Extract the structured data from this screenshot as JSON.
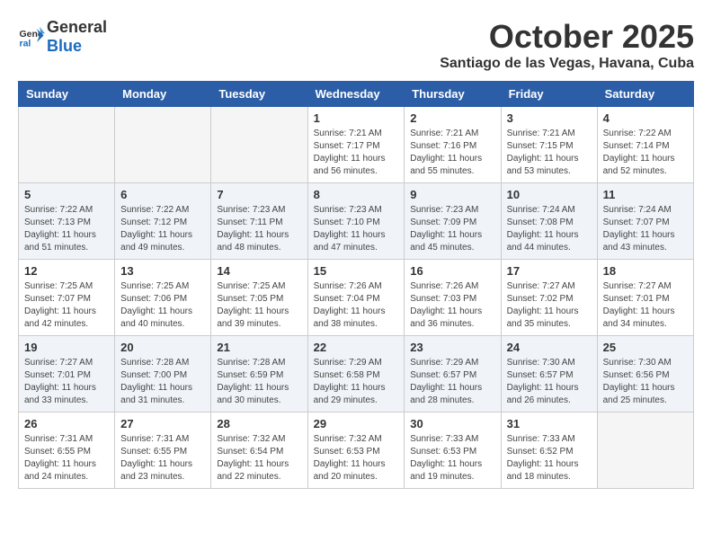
{
  "header": {
    "logo_general": "General",
    "logo_blue": "Blue",
    "month_title": "October 2025",
    "location": "Santiago de las Vegas, Havana, Cuba"
  },
  "weekdays": [
    "Sunday",
    "Monday",
    "Tuesday",
    "Wednesday",
    "Thursday",
    "Friday",
    "Saturday"
  ],
  "weeks": [
    [
      {
        "day": "",
        "info": ""
      },
      {
        "day": "",
        "info": ""
      },
      {
        "day": "",
        "info": ""
      },
      {
        "day": "1",
        "info": "Sunrise: 7:21 AM\nSunset: 7:17 PM\nDaylight: 11 hours and 56 minutes."
      },
      {
        "day": "2",
        "info": "Sunrise: 7:21 AM\nSunset: 7:16 PM\nDaylight: 11 hours and 55 minutes."
      },
      {
        "day": "3",
        "info": "Sunrise: 7:21 AM\nSunset: 7:15 PM\nDaylight: 11 hours and 53 minutes."
      },
      {
        "day": "4",
        "info": "Sunrise: 7:22 AM\nSunset: 7:14 PM\nDaylight: 11 hours and 52 minutes."
      }
    ],
    [
      {
        "day": "5",
        "info": "Sunrise: 7:22 AM\nSunset: 7:13 PM\nDaylight: 11 hours and 51 minutes."
      },
      {
        "day": "6",
        "info": "Sunrise: 7:22 AM\nSunset: 7:12 PM\nDaylight: 11 hours and 49 minutes."
      },
      {
        "day": "7",
        "info": "Sunrise: 7:23 AM\nSunset: 7:11 PM\nDaylight: 11 hours and 48 minutes."
      },
      {
        "day": "8",
        "info": "Sunrise: 7:23 AM\nSunset: 7:10 PM\nDaylight: 11 hours and 47 minutes."
      },
      {
        "day": "9",
        "info": "Sunrise: 7:23 AM\nSunset: 7:09 PM\nDaylight: 11 hours and 45 minutes."
      },
      {
        "day": "10",
        "info": "Sunrise: 7:24 AM\nSunset: 7:08 PM\nDaylight: 11 hours and 44 minutes."
      },
      {
        "day": "11",
        "info": "Sunrise: 7:24 AM\nSunset: 7:07 PM\nDaylight: 11 hours and 43 minutes."
      }
    ],
    [
      {
        "day": "12",
        "info": "Sunrise: 7:25 AM\nSunset: 7:07 PM\nDaylight: 11 hours and 42 minutes."
      },
      {
        "day": "13",
        "info": "Sunrise: 7:25 AM\nSunset: 7:06 PM\nDaylight: 11 hours and 40 minutes."
      },
      {
        "day": "14",
        "info": "Sunrise: 7:25 AM\nSunset: 7:05 PM\nDaylight: 11 hours and 39 minutes."
      },
      {
        "day": "15",
        "info": "Sunrise: 7:26 AM\nSunset: 7:04 PM\nDaylight: 11 hours and 38 minutes."
      },
      {
        "day": "16",
        "info": "Sunrise: 7:26 AM\nSunset: 7:03 PM\nDaylight: 11 hours and 36 minutes."
      },
      {
        "day": "17",
        "info": "Sunrise: 7:27 AM\nSunset: 7:02 PM\nDaylight: 11 hours and 35 minutes."
      },
      {
        "day": "18",
        "info": "Sunrise: 7:27 AM\nSunset: 7:01 PM\nDaylight: 11 hours and 34 minutes."
      }
    ],
    [
      {
        "day": "19",
        "info": "Sunrise: 7:27 AM\nSunset: 7:01 PM\nDaylight: 11 hours and 33 minutes."
      },
      {
        "day": "20",
        "info": "Sunrise: 7:28 AM\nSunset: 7:00 PM\nDaylight: 11 hours and 31 minutes."
      },
      {
        "day": "21",
        "info": "Sunrise: 7:28 AM\nSunset: 6:59 PM\nDaylight: 11 hours and 30 minutes."
      },
      {
        "day": "22",
        "info": "Sunrise: 7:29 AM\nSunset: 6:58 PM\nDaylight: 11 hours and 29 minutes."
      },
      {
        "day": "23",
        "info": "Sunrise: 7:29 AM\nSunset: 6:57 PM\nDaylight: 11 hours and 28 minutes."
      },
      {
        "day": "24",
        "info": "Sunrise: 7:30 AM\nSunset: 6:57 PM\nDaylight: 11 hours and 26 minutes."
      },
      {
        "day": "25",
        "info": "Sunrise: 7:30 AM\nSunset: 6:56 PM\nDaylight: 11 hours and 25 minutes."
      }
    ],
    [
      {
        "day": "26",
        "info": "Sunrise: 7:31 AM\nSunset: 6:55 PM\nDaylight: 11 hours and 24 minutes."
      },
      {
        "day": "27",
        "info": "Sunrise: 7:31 AM\nSunset: 6:55 PM\nDaylight: 11 hours and 23 minutes."
      },
      {
        "day": "28",
        "info": "Sunrise: 7:32 AM\nSunset: 6:54 PM\nDaylight: 11 hours and 22 minutes."
      },
      {
        "day": "29",
        "info": "Sunrise: 7:32 AM\nSunset: 6:53 PM\nDaylight: 11 hours and 20 minutes."
      },
      {
        "day": "30",
        "info": "Sunrise: 7:33 AM\nSunset: 6:53 PM\nDaylight: 11 hours and 19 minutes."
      },
      {
        "day": "31",
        "info": "Sunrise: 7:33 AM\nSunset: 6:52 PM\nDaylight: 11 hours and 18 minutes."
      },
      {
        "day": "",
        "info": ""
      }
    ]
  ]
}
